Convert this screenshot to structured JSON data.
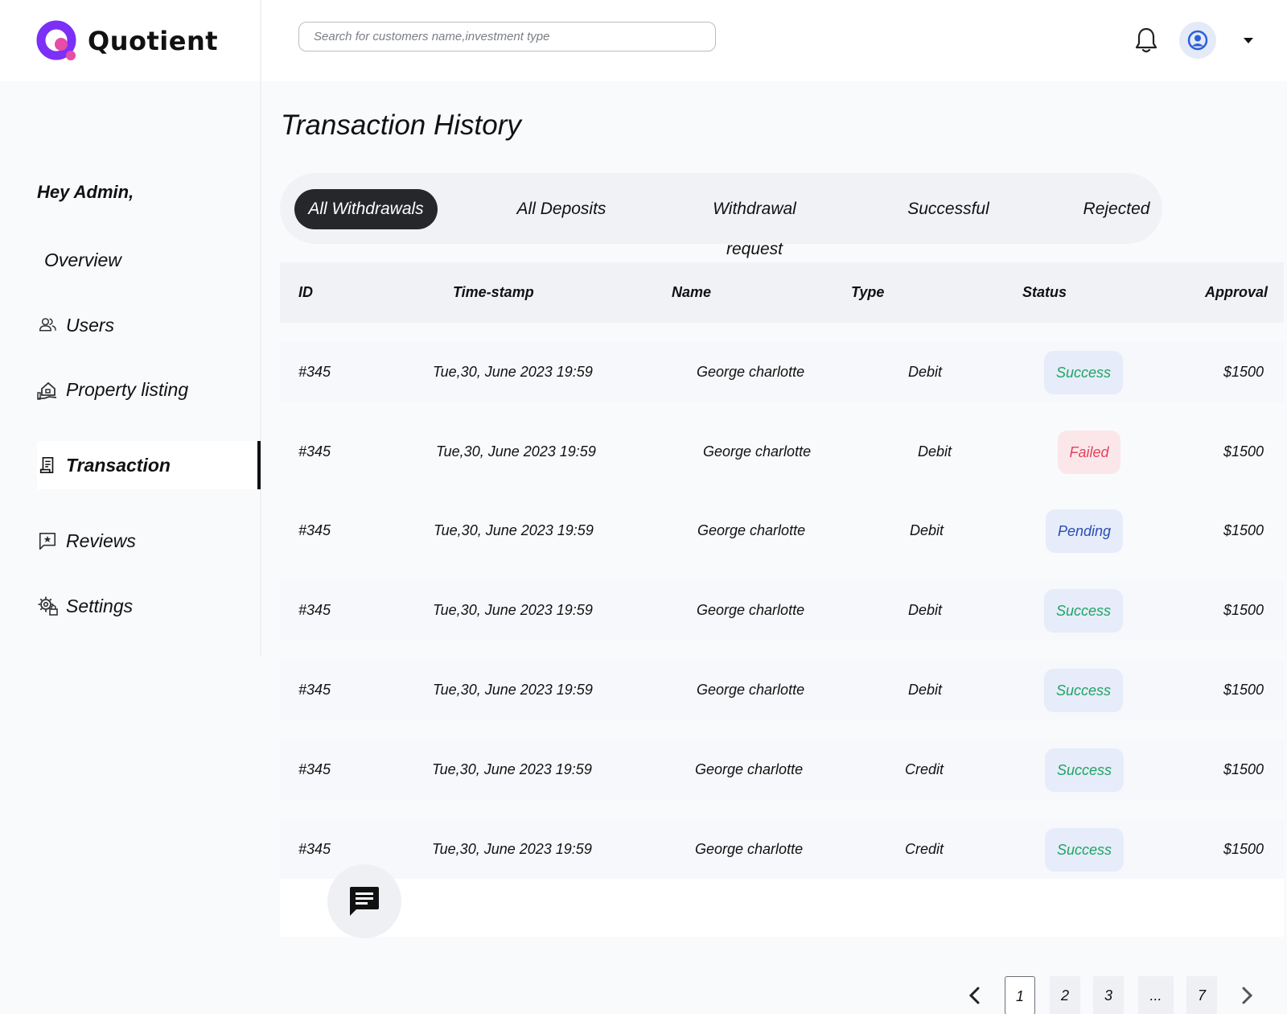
{
  "app": {
    "name": "Quotient",
    "brand_color": "#7b2ff7",
    "accent_pink": "#e74ca7"
  },
  "search": {
    "placeholder": "Search for customers name,investment type",
    "icon": "search-icon"
  },
  "header": {
    "notification_icon": "bell-icon",
    "avatar_icon": "user-circle-icon",
    "menu_icon": "caret-down-icon"
  },
  "sidebar": {
    "greeting": "Hey Admin,",
    "items": [
      {
        "label": "Overview",
        "icon": ""
      },
      {
        "label": "Users",
        "icon": "users-icon"
      },
      {
        "label": "Property listing",
        "icon": "house-hand-icon"
      },
      {
        "label": "Transaction",
        "icon": "receipt-icon",
        "active": true
      },
      {
        "label": "Reviews",
        "icon": "star-message-icon"
      },
      {
        "label": "Settings",
        "icon": "gear-lock-icon"
      }
    ]
  },
  "main": {
    "title": "Transaction History",
    "tabs": [
      "All Withdrawals",
      "All Deposits",
      "Withdrawal request",
      "Successful",
      "Rejected"
    ],
    "active_tab": "All Withdrawals",
    "table": {
      "headers": [
        "ID",
        "Time-stamp",
        "Name",
        "Type",
        "Status",
        "Approval"
      ],
      "rows": [
        {
          "id": "#345",
          "time": "Tue,30, June 2023 19:59",
          "name": "George charlotte",
          "type": "Debit",
          "status": "Success",
          "approval": "$1500"
        },
        {
          "id": "#345",
          "time": "Tue,30, June 2023 19:59",
          "name": "George charlotte",
          "type": "Debit",
          "status": "Failed",
          "approval": "$1500"
        },
        {
          "id": "#345",
          "time": "Tue,30, June 2023 19:59",
          "name": "George charlotte",
          "type": "Debit",
          "status": "Pending",
          "approval": "$1500"
        },
        {
          "id": "#345",
          "time": "Tue,30, June 2023 19:59",
          "name": "George charlotte",
          "type": "Debit",
          "status": "Success",
          "approval": "$1500"
        },
        {
          "id": "#345",
          "time": "Tue,30, June 2023 19:59",
          "name": "George charlotte",
          "type": "Debit",
          "status": "Success",
          "approval": "$1500"
        },
        {
          "id": "#345",
          "time": "Tue,30, June 2023 19:59",
          "name": "George charlotte",
          "type": "Credit",
          "status": "Success",
          "approval": "$1500"
        },
        {
          "id": "#345",
          "time": "Tue,30, June 2023 19:59",
          "name": "George charlotte",
          "type": "Credit",
          "status": "Success",
          "approval": "$1500"
        }
      ]
    },
    "status_colors": {
      "Success": "#1fa463",
      "Failed": "#e0455c",
      "Pending": "#2a4cb6"
    }
  },
  "chat": {
    "icon": "chat-message-icon"
  },
  "pagination": {
    "pages": [
      "1",
      "2",
      "3",
      "...",
      "7"
    ],
    "current": "1",
    "prev_icon": "chevron-left-icon",
    "next_icon": "chevron-right-icon"
  }
}
